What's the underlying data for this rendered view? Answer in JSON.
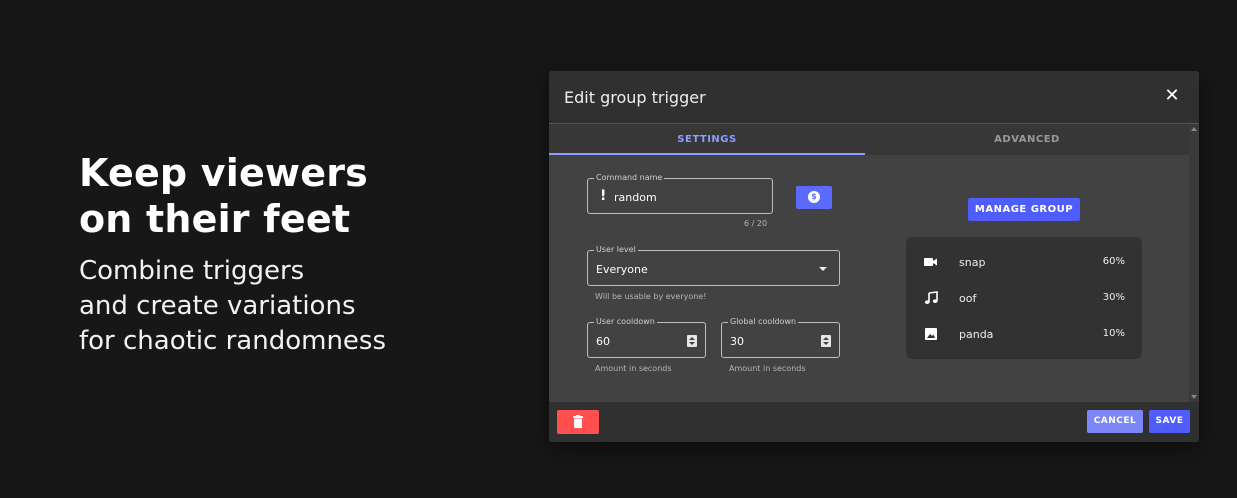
{
  "hero": {
    "title": "Keep viewers\non their feet",
    "subtitle": "Combine triggers\nand create variations\nfor chaotic randomness"
  },
  "dialog": {
    "title": "Edit group trigger",
    "close_icon": "close-icon",
    "tabs": [
      {
        "label": "SETTINGS",
        "active": true
      },
      {
        "label": "ADVANCED",
        "active": false
      }
    ],
    "command": {
      "label": "Command name",
      "prefix": "!",
      "value": "random",
      "counter": "6 / 20",
      "coin_glyph": "$"
    },
    "user_level": {
      "label": "User level",
      "value": "Everyone",
      "helper": "Will be usable by everyone!"
    },
    "user_cooldown": {
      "label": "User cooldown",
      "value": "60",
      "helper": "Amount in seconds"
    },
    "global_cooldown": {
      "label": "Global cooldown",
      "value": "30",
      "helper": "Amount in seconds"
    },
    "manage_group_label": "MANAGE GROUP",
    "group_items": [
      {
        "icon": "video-icon",
        "name": "snap",
        "percent": "60%"
      },
      {
        "icon": "music-note-icon",
        "name": "oof",
        "percent": "30%"
      },
      {
        "icon": "image-icon",
        "name": "panda",
        "percent": "10%"
      }
    ],
    "footer": {
      "delete_icon": "trash-icon",
      "cancel_label": "CANCEL",
      "save_label": "SAVE"
    }
  },
  "colors": {
    "background": "#171717",
    "dialog": "#424242",
    "accent": "#4f5dff",
    "tab_active": "#8c9cff",
    "cancel": "#7c86f6",
    "danger": "#ff4f4f"
  }
}
